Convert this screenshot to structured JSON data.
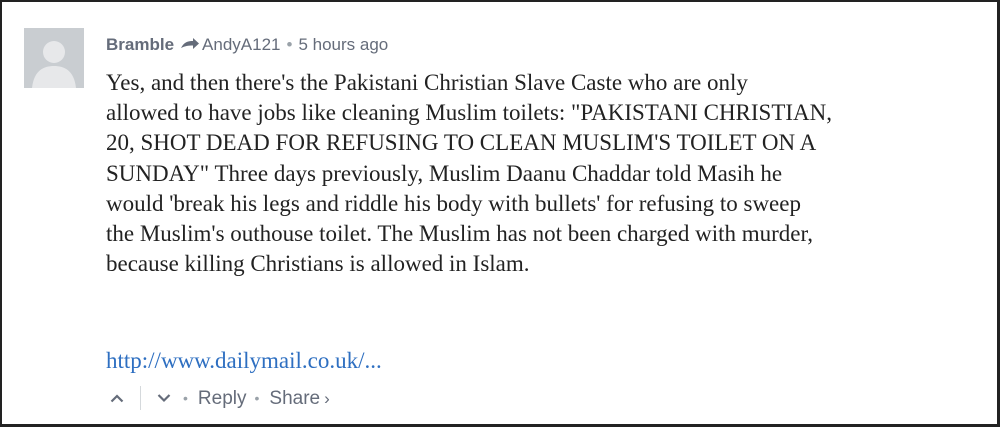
{
  "comment": {
    "author": "Bramble",
    "reply_to": "AndyA121",
    "separator": "•",
    "timestamp": "5 hours ago",
    "body_lines": [
      "Yes, and then there's the Pakistani Christian Slave Caste who are only",
      "allowed to have jobs like cleaning Muslim toilets: \"PAKISTANI CHRISTIAN,",
      "20, SHOT DEAD FOR REFUSING TO CLEAN MUSLIM'S TOILET ON A",
      "SUNDAY\" Three days previously, Muslim Daanu Chaddar told Masih he",
      "would 'break his legs and riddle his body with bullets' for refusing to sweep",
      "the Muslim's outhouse toilet. The Muslim has not been charged with murder,",
      "because killing Christians is allowed in Islam."
    ],
    "link_text": "http://www.dailymail.co.uk/...",
    "actions": {
      "separator": "•",
      "reply": "Reply",
      "share": "Share",
      "share_chevron": "›"
    }
  },
  "icons": {
    "avatar": "default-avatar-icon",
    "reply_arrow": "reply-arrow-icon",
    "upvote": "chevron-up-icon",
    "downvote": "chevron-down-icon"
  },
  "colors": {
    "meta_text": "#656c7a",
    "body_text": "#222222",
    "link": "#2e6fc1",
    "avatar_bg": "#c9cdd1",
    "border": "#222222"
  }
}
